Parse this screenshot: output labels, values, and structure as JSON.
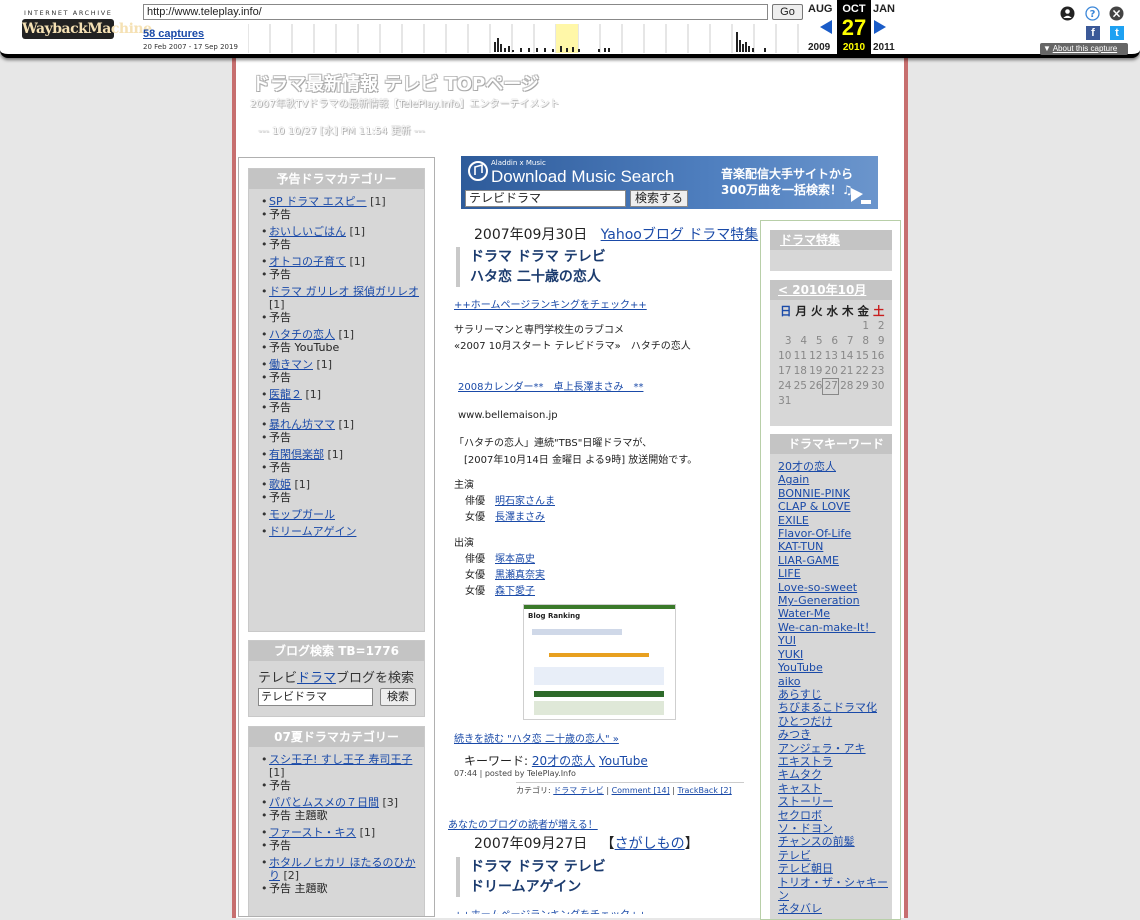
{
  "wayback": {
    "ia_text": "INTERNET ARCHIVE",
    "logo_text": "WaybackMachine",
    "url": "http://www.teleplay.info/",
    "go_label": "Go",
    "captures_label": "58 captures",
    "date_range": "20 Feb 2007 - 17 Sep 2019",
    "months": [
      "AUG",
      "OCT",
      "JAN"
    ],
    "years": [
      "2009",
      "2010",
      "2011"
    ],
    "current_day": "27",
    "about_label": "About this capture",
    "facebook_glyph": "f",
    "twitter_glyph": "t",
    "help_glyph": "?",
    "close_glyph": "×",
    "accent_color": "#1a5cc8"
  },
  "header": {
    "title": "ドラマ最新情報 テレビ TOPページ",
    "subtitle": "2007年秋TVドラマの最新情報【TelePlay.Info】エンターテイメント",
    "updated": "--- 10 10/27 [水] PM 11:54 更新 ---"
  },
  "left": {
    "box1_title": "予告ドラマカテゴリー",
    "box1_items": [
      {
        "link": "SP ドラマ エスピー",
        "count": "[1]",
        "sub": "予告"
      },
      {
        "link": "おいしいごはん",
        "count": "[1]",
        "sub": "予告"
      },
      {
        "link": "オトコの子育て",
        "count": "[1]",
        "sub": "予告"
      },
      {
        "link": "ドラマ ガリレオ 探偵ガリレオ",
        "count": "[1]",
        "sub": "予告"
      },
      {
        "link": "ハタチの恋人",
        "count": "[1]",
        "sub": "予告 YouTube"
      },
      {
        "link": "働きマン",
        "count": "[1]",
        "sub": "予告"
      },
      {
        "link": "医龍２",
        "count": "[1]",
        "sub": "予告"
      },
      {
        "link": "暴れん坊ママ",
        "count": "[1]",
        "sub": "予告"
      },
      {
        "link": "有閑倶楽部",
        "count": "[1]",
        "sub": "予告"
      },
      {
        "link": "歌姫",
        "count": "[1]",
        "sub": "予告"
      },
      {
        "link": "モップガール",
        "count": "",
        "sub": ""
      },
      {
        "link": "ドリームアゲイン",
        "count": "",
        "sub": ""
      }
    ],
    "search_title": "ブログ検索 TB=1776",
    "search_label_pre": "テレビ",
    "search_label_link": "ドラマ",
    "search_label_post": "ブログを検索",
    "search_value": "テレビドラマ",
    "search_button": "検索",
    "box2_title": "07夏ドラマカテゴリー",
    "box2_items": [
      {
        "link": "スシ王子! すし王子 寿司王子",
        "count": "[1]",
        "sub": "予告"
      },
      {
        "link": "パパとムスメの７日間",
        "count": "[3]",
        "sub": "予告 主題歌"
      },
      {
        "link": "ファースト・キス",
        "count": "[1]",
        "sub": "予告"
      },
      {
        "link": "ホタルノヒカリ ほたるのひかり",
        "count": "[2]",
        "sub": "予告 主題歌"
      }
    ]
  },
  "banner": {
    "brand": "Aladdin x Music",
    "title": "Download Music Search",
    "input_value": "テレビドラマ",
    "button": "検索する",
    "promo": "音楽配信大手サイトから 300万曲を一括検索！♫"
  },
  "post1": {
    "date": "2007年09月30日",
    "link": "Yahooブログ ドラマ特集",
    "head1": "ドラマ ドラマ テレビ",
    "head2": "ハタ恋 二十歳の恋人",
    "ranking": "++ホームページランキングをチェック++",
    "desc1": "サラリーマンと専門学校生のラブコメ",
    "desc2": "«2007 10月スタート テレビドラマ»　ハタチの恋人",
    "cal_link": "2008カレンダー**　卓上長澤まさみ　**",
    "site": "www.bellemaison.jp",
    "info1": "「ハタチの恋人」連続\"TBS\"日曜ドラマが、",
    "info2": "[2007年10月14日 金曜日 よる9時] 放送開始です。",
    "cast_main_label": "主演",
    "cast_main": [
      {
        "role": "俳優",
        "name": "明石家さんま"
      },
      {
        "role": "女優",
        "name": "長澤まさみ"
      }
    ],
    "cast_label": "出演",
    "cast": [
      {
        "role": "俳優",
        "name": "塚本高史"
      },
      {
        "role": "女優",
        "name": "黒瀬真奈実"
      },
      {
        "role": "女優",
        "name": "森下愛子"
      }
    ],
    "screenshot_text": "Blog Ranking",
    "more": "続きを読む \"ハタ恋 二十歳の恋人\" »",
    "keyword_label": "キーワード:",
    "keyword1": "20才の恋人",
    "keyword2": "YouTube",
    "posted": "07:44 | posted by TelePlay.Info",
    "cat_label": "カテゴリ:",
    "cat_link": "ドラマ テレビ",
    "comment_link": "Comment [14]",
    "tb_link": "TrackBack [2]",
    "promo": "あなたのブログの読者が増える！"
  },
  "post2": {
    "date": "2007年09月27日",
    "bracket_open": "【",
    "link": "さがしもの",
    "bracket_close": "】",
    "head1": "ドラマ ドラマ テレビ",
    "head2": "ドリームアゲイン",
    "ranking": "++ホームページランキングをチェック++"
  },
  "right": {
    "special_title": "ドラマ特集",
    "calendar_title": "< 2010年10月",
    "weekdays": [
      "日",
      "月",
      "火",
      "水",
      "木",
      "金",
      "土"
    ],
    "weeks": [
      [
        "",
        "",
        "",
        "",
        "",
        "1",
        "2"
      ],
      [
        "3",
        "4",
        "5",
        "6",
        "7",
        "8",
        "9"
      ],
      [
        "10",
        "11",
        "12",
        "13",
        "14",
        "15",
        "16"
      ],
      [
        "17",
        "18",
        "19",
        "20",
        "21",
        "22",
        "23"
      ],
      [
        "24",
        "25",
        "26",
        "27",
        "28",
        "29",
        "30"
      ],
      [
        "31",
        "",
        "",
        "",
        "",
        "",
        ""
      ]
    ],
    "today": "27",
    "keyword_title": "ドラマキーワード",
    "keywords": [
      "20才の恋人",
      "Again",
      "BONNIE-PINK",
      "CLAP & LOVE",
      "EXILE",
      "Flavor-Of-Life",
      "KAT-TUN",
      "LIAR-GAME",
      "LIFE",
      "Love-so-sweet",
      "My-Generation",
      "Water-Me",
      "We-can-make-It！",
      "YUI",
      "YUKI",
      "YouTube",
      "aiko",
      "あらすじ",
      "ちびまるこドラマ化",
      "ひとつだけ",
      "みつき",
      "アンジェラ・アキ",
      "エキストラ",
      "キムタク",
      "キャスト",
      "ストーリー",
      "セクロボ",
      "ソ・ドヨン",
      "チャンスの前髪",
      "テレビ",
      "テレビ朝日",
      "トリオ・ザ・シャキーン",
      "ネタバレ"
    ]
  }
}
